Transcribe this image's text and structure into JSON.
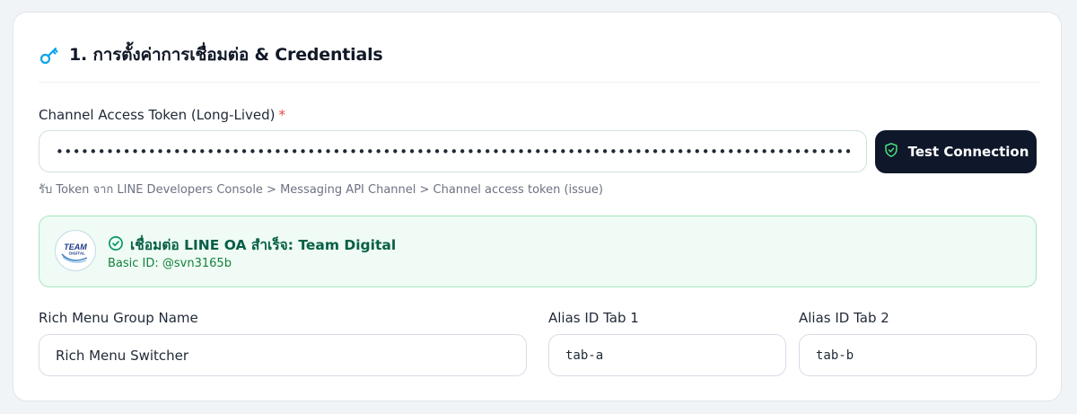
{
  "section": {
    "icon": "key-icon",
    "title": "1. การตั้งค่าการเชื่อมต่อ & Credentials"
  },
  "token": {
    "label": "Channel Access Token (Long-Lived)",
    "required_mark": "*",
    "masked_value": "•••••••••••••••••••••••••••••••••••••••••••••••••••••••••••••••••••••••••••••••••••••••••••••••••••••••••••••••••••••••••••••••",
    "hint": "รับ Token จาก LINE Developers Console > Messaging API Channel > Channel access token (issue)"
  },
  "test_button": {
    "label": "Test Connection",
    "icon": "shield-check-icon"
  },
  "connection_status": {
    "title": "เชื่อมต่อ LINE OA สำเร็จ: Team Digital",
    "basic_id": "Basic ID: @svn3165b",
    "avatar_line1": "TEAM",
    "avatar_line2": "DIGITAL",
    "icon": "check-circle-icon"
  },
  "rich_menu": {
    "group_label": "Rich Menu Group Name",
    "group_value": "Rich Menu Switcher",
    "alias1_label": "Alias ID Tab 1",
    "alias1_value": "tab-a",
    "alias2_label": "Alias ID Tab 2",
    "alias2_value": "tab-b"
  },
  "colors": {
    "primary_dark": "#0f172a",
    "accent_blue": "#0ea5e9",
    "success_bg": "#effbf4",
    "success_border": "#a7e5c0",
    "success_text": "#065f46",
    "required_red": "#ef4444"
  }
}
